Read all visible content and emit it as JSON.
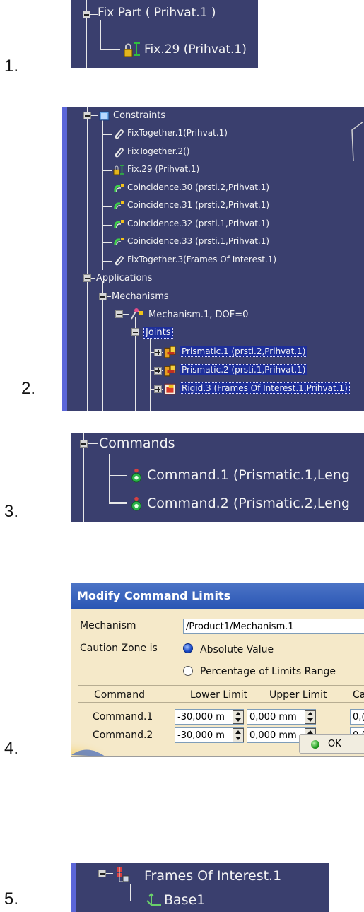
{
  "steps": [
    "1.",
    "2.",
    "3.",
    "4.",
    "5."
  ],
  "panel1": {
    "parent_label": "Fix Part ( Prihvat.1 )",
    "child_label": "Fix.29 (Prihvat.1)"
  },
  "panel2": {
    "constraints_label": "Constraints",
    "constraint_items": [
      {
        "icon": "fix-together-icon",
        "label": "FixTogether.1(Prihvat.1)"
      },
      {
        "icon": "fix-together-icon",
        "label": "FixTogether.2()"
      },
      {
        "icon": "fix-icon",
        "label": "Fix.29 (Prihvat.1)"
      },
      {
        "icon": "coincidence-icon",
        "label": "Coincidence.30 (prsti.2,Prihvat.1)"
      },
      {
        "icon": "coincidence-icon",
        "label": "Coincidence.31 (prsti.2,Prihvat.1)"
      },
      {
        "icon": "coincidence-icon",
        "label": "Coincidence.32 (prsti.1,Prihvat.1)"
      },
      {
        "icon": "coincidence-icon",
        "label": "Coincidence.33 (prsti.1,Prihvat.1)"
      },
      {
        "icon": "fix-together-icon",
        "label": "FixTogether.3(Frames Of Interest.1)"
      }
    ],
    "applications_label": "Applications",
    "mechanisms_label": "Mechanisms",
    "mechanism_label": "Mechanism.1, DOF=0",
    "joints_label": "Joints",
    "joint_items": [
      {
        "icon": "prismatic-joint-icon",
        "label": "Prismatic.1 (prsti.2,Prihvat.1)"
      },
      {
        "icon": "prismatic-joint-icon",
        "label": "Prismatic.2 (prsti.1,Prihvat.1)"
      },
      {
        "icon": "rigid-joint-icon",
        "label": "Rigid.3 (Frames Of Interest.1,Prihvat.1)"
      }
    ]
  },
  "panel3": {
    "commands_label": "Commands",
    "command_items": [
      {
        "icon": "command-icon",
        "label": "Command.1 (Prismatic.1,Leng"
      },
      {
        "icon": "command-icon",
        "label": "Command.2 (Prismatic.2,Leng"
      }
    ]
  },
  "panel4": {
    "title": "Modify Command Limits",
    "mechanism_label": "Mechanism",
    "mechanism_value": "/Product1/Mechanism.1",
    "caution_label": "Caution Zone is",
    "option_absolute": "Absolute Value",
    "option_percentage": "Percentage of Limits Range",
    "selected_option": "Absolute Value",
    "col_command": "Command",
    "col_lower": "Lower Limit",
    "col_upper": "Upper Limit",
    "col_caution": "Ca",
    "rows": [
      {
        "command": "Command.1",
        "lower": "-30,000 m",
        "upper": "0,000 mm",
        "caution": "0,("
      },
      {
        "command": "Command.2",
        "lower": "-30,000 m",
        "upper": "0,000 mm",
        "caution": "0,("
      }
    ],
    "ok_label": "OK"
  },
  "panel5": {
    "parent_label": "Frames Of Interest.1",
    "child_label": "Base1"
  },
  "colors": {
    "tree_background": "#3a3f6e",
    "tree_selection": "#1e2f9a",
    "dialog_title": "#2a56b4",
    "dialog_background": "#f5e9c9"
  }
}
